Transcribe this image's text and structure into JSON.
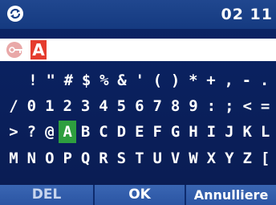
{
  "status": {
    "sync_icon": "sync-icon",
    "time": "02 11"
  },
  "input": {
    "key_icon": "key-icon",
    "value": "A"
  },
  "keyboard": {
    "rows": [
      [
        "!",
        "\"",
        "#",
        "$",
        "%",
        "&",
        "'",
        "(",
        ")",
        "*",
        "+",
        ",",
        "-",
        "."
      ],
      [
        "/",
        "0",
        "1",
        "2",
        "3",
        "4",
        "5",
        "6",
        "7",
        "8",
        "9",
        ":",
        ";",
        "<",
        "="
      ],
      [
        ">",
        "?",
        "@",
        "A",
        "B",
        "C",
        "D",
        "E",
        "F",
        "G",
        "H",
        "I",
        "J",
        "K",
        "L"
      ],
      [
        "M",
        "N",
        "O",
        "P",
        "Q",
        "R",
        "S",
        "T",
        "U",
        "V",
        "W",
        "X",
        "Y",
        "Z",
        "["
      ]
    ],
    "selected": "A"
  },
  "softkeys": {
    "left": "DEL",
    "center": "OK",
    "right": "Annulliere"
  },
  "colors": {
    "background": "#0b2466",
    "selection": "#2e9e3f",
    "input_highlight": "#e53c2e",
    "softkey_bar": "#3a66b3"
  }
}
